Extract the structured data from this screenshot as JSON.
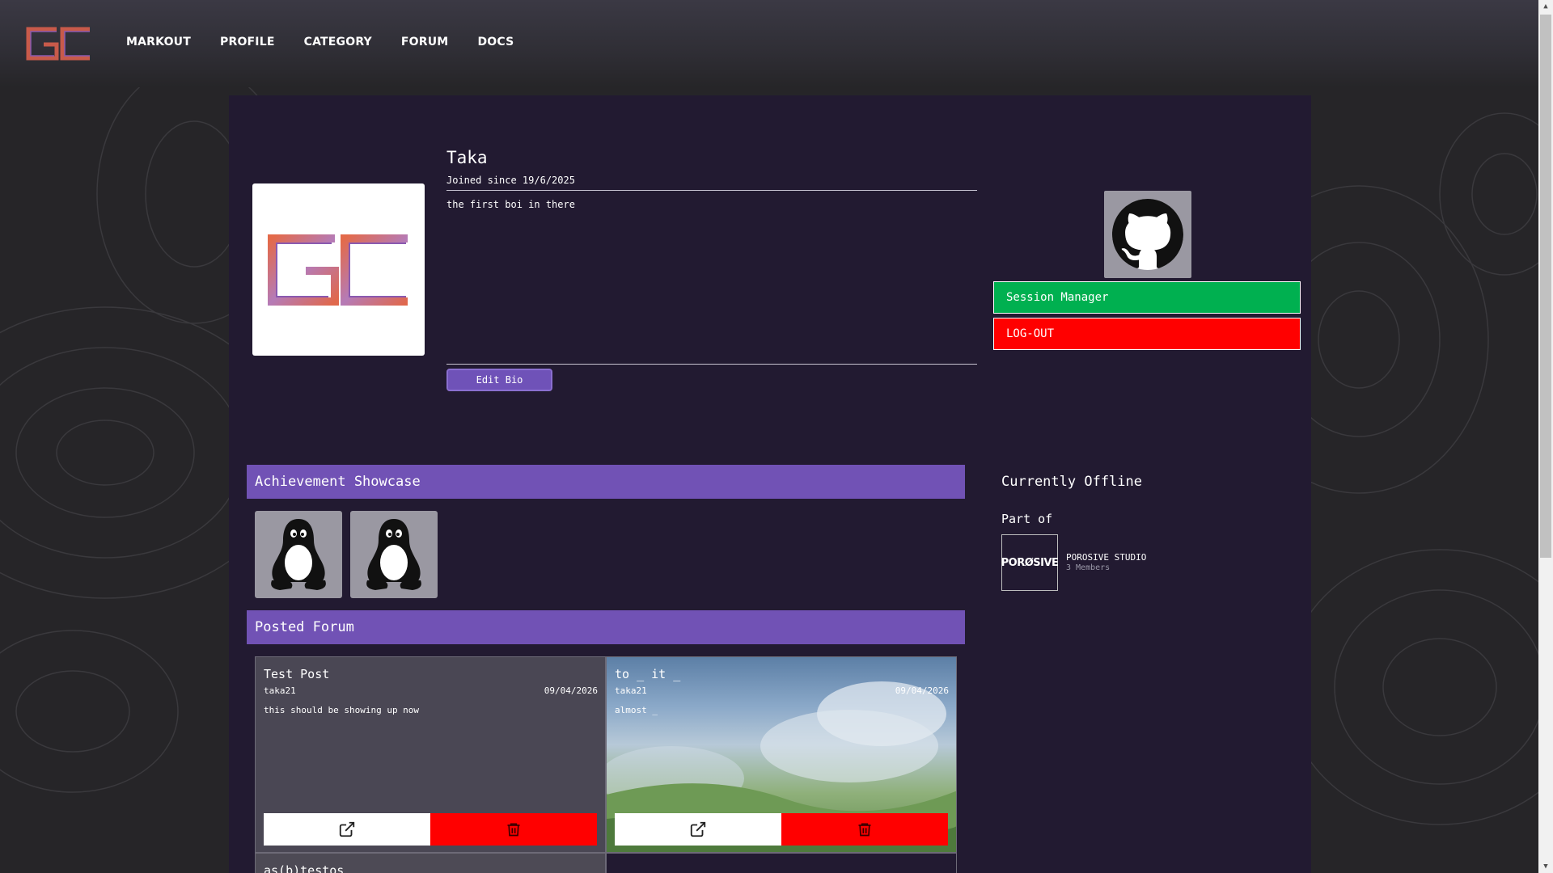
{
  "nav": {
    "items": [
      "MARKOUT",
      "PROFILE",
      "CATEGORY",
      "FORUM",
      "DOCS"
    ]
  },
  "profile": {
    "username": "Taka",
    "joined": "Joined since 19/6/2025",
    "bio": "the first boi in there",
    "edit_bio_label": "Edit Bio"
  },
  "actions": {
    "session_label": "Session Manager",
    "logout_label": "LOG-OUT"
  },
  "sections": {
    "achievements_title": "Achievement Showcase",
    "forum_title": "Posted Forum"
  },
  "status": {
    "text": "Currently Offline",
    "part_of": "Part of"
  },
  "studio": {
    "logo_text": "PORØSIVE",
    "name": "POROSIVE STUDIO",
    "members": "3 Members"
  },
  "posts": [
    {
      "title": "Test Post",
      "author": "taka21",
      "date": "09/04/2026",
      "body": "this should be showing up now"
    },
    {
      "title": "to _ it _",
      "author": "taka21",
      "date": "09/04/2026",
      "body": "almost _"
    },
    {
      "title": "as(b)testos"
    }
  ],
  "colors": {
    "accent": "#7152b5",
    "panel": "#221a31",
    "session": "#00b050",
    "logout": "#ff0000"
  },
  "icons": {
    "achievement": "linux-tux-icon",
    "social": "github-icon",
    "open": "external-link-icon",
    "delete": "trash-icon"
  }
}
